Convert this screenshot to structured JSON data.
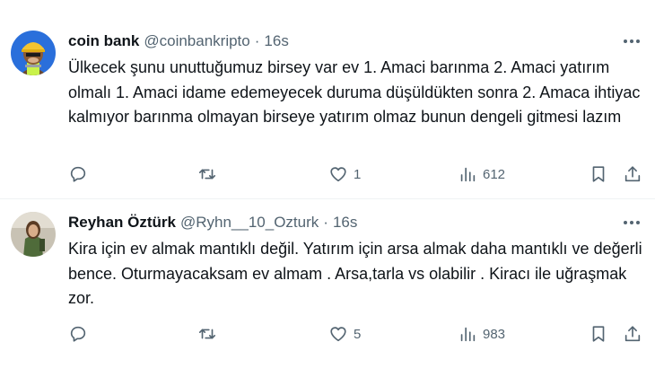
{
  "tweets": [
    {
      "name": "coin bank",
      "handle": "@coinbankripto",
      "dot": "·",
      "time": "16s",
      "text": "Ülkecek şunu unuttuğumuz birsey var ev 1. Amaci barınma 2. Amaci yatırım olmalı 1. Amaci idame edemeyecek duruma düşüldükten sonra 2. Amaca ihtiyac kalmıyor barınma olmayan birseye yatırım olmaz bunun dengeli gitmesi lazım",
      "replies": "",
      "retweets": "",
      "likes": "1",
      "views": "612"
    },
    {
      "name": "Reyhan Öztürk",
      "handle": "@Ryhn__10_Ozturk",
      "dot": "·",
      "time": "16s",
      "text": "Kira için ev almak mantıklı değil. Yatırım için arsa almak daha mantıklı ve değerli bence. Oturmayacaksam ev almam . Arsa,tarla vs olabilir . Kiracı ile uğraşmak zor.",
      "replies": "",
      "retweets": "",
      "likes": "5",
      "views": "983"
    }
  ],
  "colors": {
    "text_primary": "#0f1419",
    "text_secondary": "#536471",
    "divider": "#eff3f4"
  },
  "icons": [
    "reply-icon",
    "retweet-icon",
    "like-icon",
    "views-icon",
    "bookmark-icon",
    "share-icon",
    "more-icon"
  ]
}
